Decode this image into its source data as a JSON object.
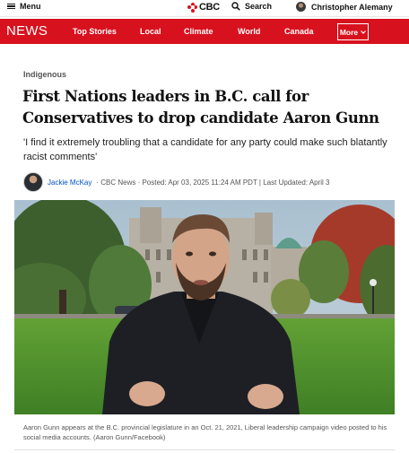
{
  "header": {
    "menu_label": "Menu",
    "logo_text": "CBC",
    "search_label": "Search",
    "user_name": "Christopher Alemany"
  },
  "nav": {
    "section_name": "NEWS",
    "items": [
      "Top Stories",
      "Local",
      "Climate",
      "World",
      "Canada"
    ],
    "more_label": "More"
  },
  "article": {
    "kicker": "Indigenous",
    "headline": "First Nations leaders in B.C. call for Conservatives to drop candidate Aaron Gunn",
    "deck": "'I find it extremely troubling that a candidate for any party could make such blatantly racist comments'",
    "author": "Jackie McKay",
    "meta": "· CBC News · Posted: Apr 03, 2025 11:24 AM PDT | Last Updated: April 3",
    "caption": "Aaron Gunn appears at the B.C. provincial legislature in an Oct. 21, 2021, Liberal leadership campaign video posted to his social media accounts. (Aaron Gunn/Facebook)"
  },
  "colors": {
    "brand_red": "#d8111e",
    "link_blue": "#0050c8"
  },
  "icons": [
    "hamburger-icon",
    "cbc-gem-icon",
    "search-icon",
    "user-avatar",
    "chevron-down-icon"
  ]
}
